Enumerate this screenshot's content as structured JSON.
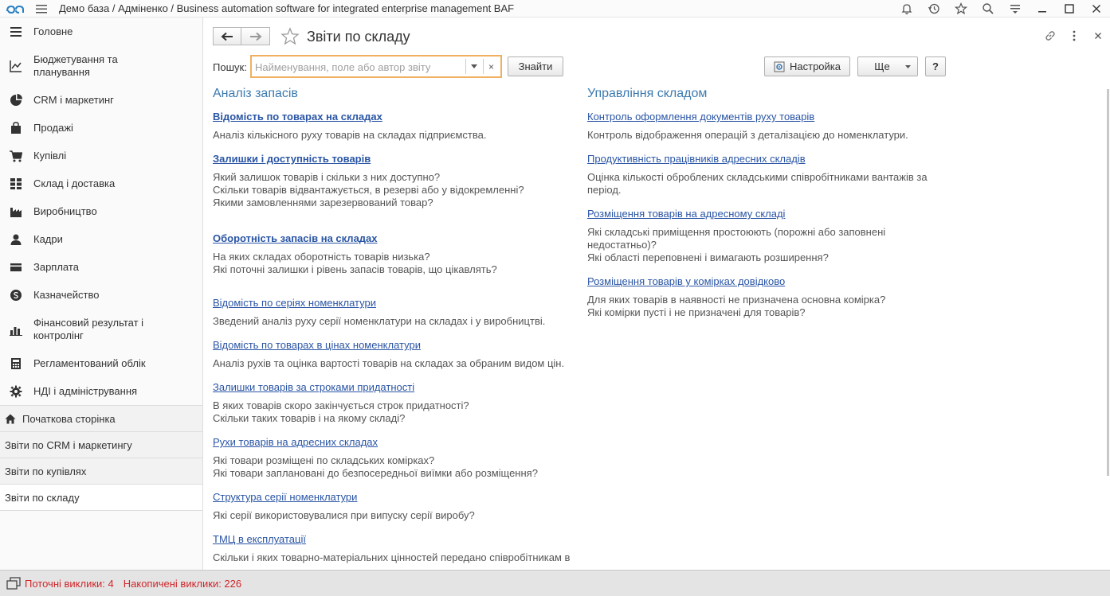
{
  "window": {
    "title": "Демо база / Адміненко / Business automation software for integrated enterprise management BAF"
  },
  "top_icons": [
    "bell-icon",
    "history-icon",
    "star-icon",
    "search-icon",
    "settings-icon",
    "minimize-icon",
    "maximize-icon",
    "close-icon"
  ],
  "sidebar": {
    "sections": [
      {
        "label": "Головне",
        "icon": "menu-icon"
      },
      {
        "label": "Бюджетування та планування",
        "icon": "chart-line-icon"
      },
      {
        "label": "CRM і маркетинг",
        "icon": "pie-chart-icon"
      },
      {
        "label": "Продажі",
        "icon": "bag-icon"
      },
      {
        "label": "Купівлі",
        "icon": "cart-icon"
      },
      {
        "label": "Склад і доставка",
        "icon": "grid-icon"
      },
      {
        "label": "Виробництво",
        "icon": "factory-icon"
      },
      {
        "label": "Кадри",
        "icon": "person-icon"
      },
      {
        "label": "Зарплата",
        "icon": "wallet-icon"
      },
      {
        "label": "Казначейство",
        "icon": "coin-icon"
      },
      {
        "label": "Фінансовий результат і контролінг",
        "icon": "bar-chart-icon"
      },
      {
        "label": "Регламентований облік",
        "icon": "calculator-icon"
      },
      {
        "label": "НДІ і адміністрування",
        "icon": "gear-icon"
      }
    ],
    "open_windows": [
      {
        "label": "Початкова сторінка"
      },
      {
        "label": "Звіти по CRM і маркетингу"
      },
      {
        "label": "Звіти по купівлях"
      },
      {
        "label": "Звіти по складу"
      }
    ]
  },
  "page": {
    "title": "Звіти по складу",
    "search": {
      "label": "Пошук:",
      "placeholder": "Найменування, поле або автор звіту",
      "value": "",
      "clear_glyph": "×"
    },
    "buttons": {
      "find": "Знайти",
      "settings": "Настройка",
      "more": "Ще",
      "help": "?"
    }
  },
  "groups": {
    "left": {
      "title": "Аналіз запасів",
      "reports": [
        {
          "title": "Відомість по товарах на складах",
          "bold": true,
          "desc": "Аналіз кількісного руху товарів на складах підприємства."
        },
        {
          "title": "Залишки і доступність товарів",
          "bold": true,
          "desc": "Який залишок товарів і скільки з них доступно?\nСкільки товарів відвантажується, в резерві або у відокремленні?\nЯкими замовленнями зарезервований товар?"
        },
        {
          "title": "Оборотність запасів на складах",
          "bold": true,
          "desc": "На яких складах оборотність товарів низька?\nЯкі поточні залишки і рівень запасів товарів, що цікавлять?"
        },
        {
          "title": "Відомість по серіях номенклатури",
          "bold": false,
          "desc": "Зведений аналіз руху серії номенклатури на складах і у виробництві."
        },
        {
          "title": "Відомість по товарах в цінах номенклатури",
          "bold": false,
          "desc": "Аналіз рухів та оцінка вартості товарів на складах за обраним видом цін."
        },
        {
          "title": "Залишки товарів за строками придатності",
          "bold": false,
          "desc": "В яких товарів скоро закінчується строк придатності?\nСкільки таких товарів і на якому складі?"
        },
        {
          "title": "Рухи товарів на адресних складах",
          "bold": false,
          "desc": "Які товари розміщені по складських комірках?\nЯкі товари заплановані до безпосередньої виїмки або розміщення?"
        },
        {
          "title": "Структура серії номенклатури",
          "bold": false,
          "desc": "Які серії використовувалися при випуску серії виробу?"
        },
        {
          "title": "ТМЦ в експлуатації",
          "bold": false,
          "desc": "Скільки і яких товарно-матеріальних цінностей передано співробітникам в"
        }
      ]
    },
    "right": {
      "title": "Управління складом",
      "reports": [
        {
          "title": "Контроль оформлення документів руху товарів",
          "bold": false,
          "desc": "Контроль відображення операцій з деталізацією до номенклатури."
        },
        {
          "title": "Продуктивність працівників адресних складів",
          "bold": false,
          "desc": "Оцінка кількості оброблених складськими співробітниками вантажів за\nперіод."
        },
        {
          "title": "Розміщення товарів на адресному складі",
          "bold": false,
          "desc": "Які складські приміщення простоюють (порожні або заповнені\nнедостатньо)?\nЯкі області переповнені і вимагають розширення?"
        },
        {
          "title": "Розміщення товарів у комірках довідково",
          "bold": false,
          "desc": "Для яких товарів в наявності не призначена основна комірка?\nЯкі комірки пусті і не призначені для товарів?"
        }
      ]
    }
  },
  "statusbar": {
    "current_calls": "Поточні виклики: 4",
    "accumulated_calls": "Накопичені виклики: 226"
  },
  "colors": {
    "accent_link": "#2a55a5",
    "group_title": "#3c7ab0",
    "status_red": "#d0262b",
    "search_border": "#f0b060"
  }
}
